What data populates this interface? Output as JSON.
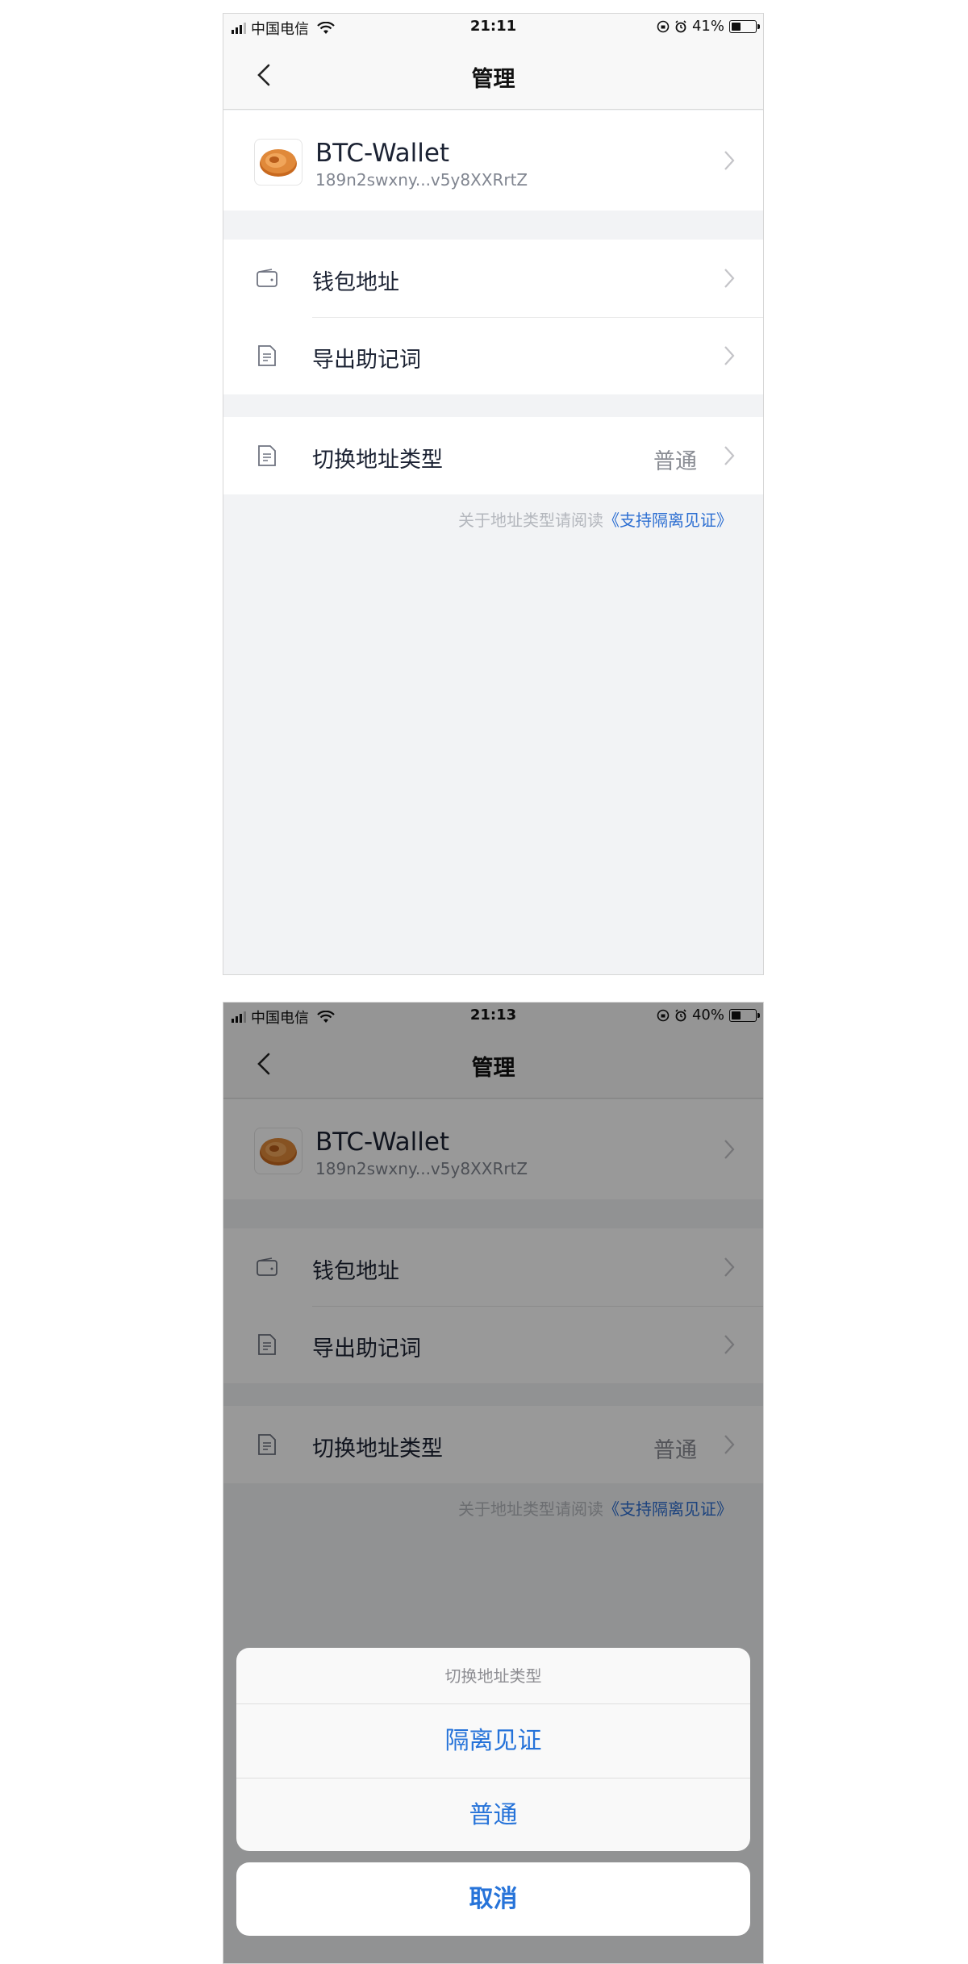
{
  "colors": {
    "accent": "#2673d9",
    "link": "#2d6fd2",
    "background": "#f2f3f5",
    "coin": "#e0893a"
  },
  "screen1": {
    "status": {
      "carrier": "中国电信",
      "time": "21:11",
      "battery": "41%",
      "battery_level": 0.41
    },
    "nav": {
      "title": "管理",
      "back_icon": "chevron-left-icon"
    },
    "wallet": {
      "name": "BTC-Wallet",
      "address": "189n2swxny...v5y8XXRrtZ",
      "logo_icon": "bitcoin-coin-icon"
    },
    "rows": [
      {
        "label": "钱包地址",
        "icon": "wallet-icon"
      },
      {
        "label": "导出助记词",
        "icon": "document-icon"
      }
    ],
    "switch_row": {
      "label": "切换地址类型",
      "value": "普通",
      "icon": "document-icon"
    },
    "hint": {
      "text": "关于地址类型请阅读",
      "link": "《支持隔离见证》"
    }
  },
  "screen2": {
    "status": {
      "carrier": "中国电信",
      "time": "21:13",
      "battery": "40%",
      "battery_level": 0.4
    },
    "nav": {
      "title": "管理"
    },
    "wallet": {
      "name": "BTC-Wallet",
      "address": "189n2swxny...v5y8XXRrtZ"
    },
    "rows": [
      {
        "label": "钱包地址"
      },
      {
        "label": "导出助记词"
      }
    ],
    "switch_row": {
      "label": "切换地址类型",
      "value": "普通"
    },
    "hint": {
      "text": "关于地址类型请阅读",
      "link": "《支持隔离见证》"
    },
    "sheet": {
      "title": "切换地址类型",
      "options": [
        "隔离见证",
        "普通"
      ],
      "cancel": "取消"
    }
  }
}
